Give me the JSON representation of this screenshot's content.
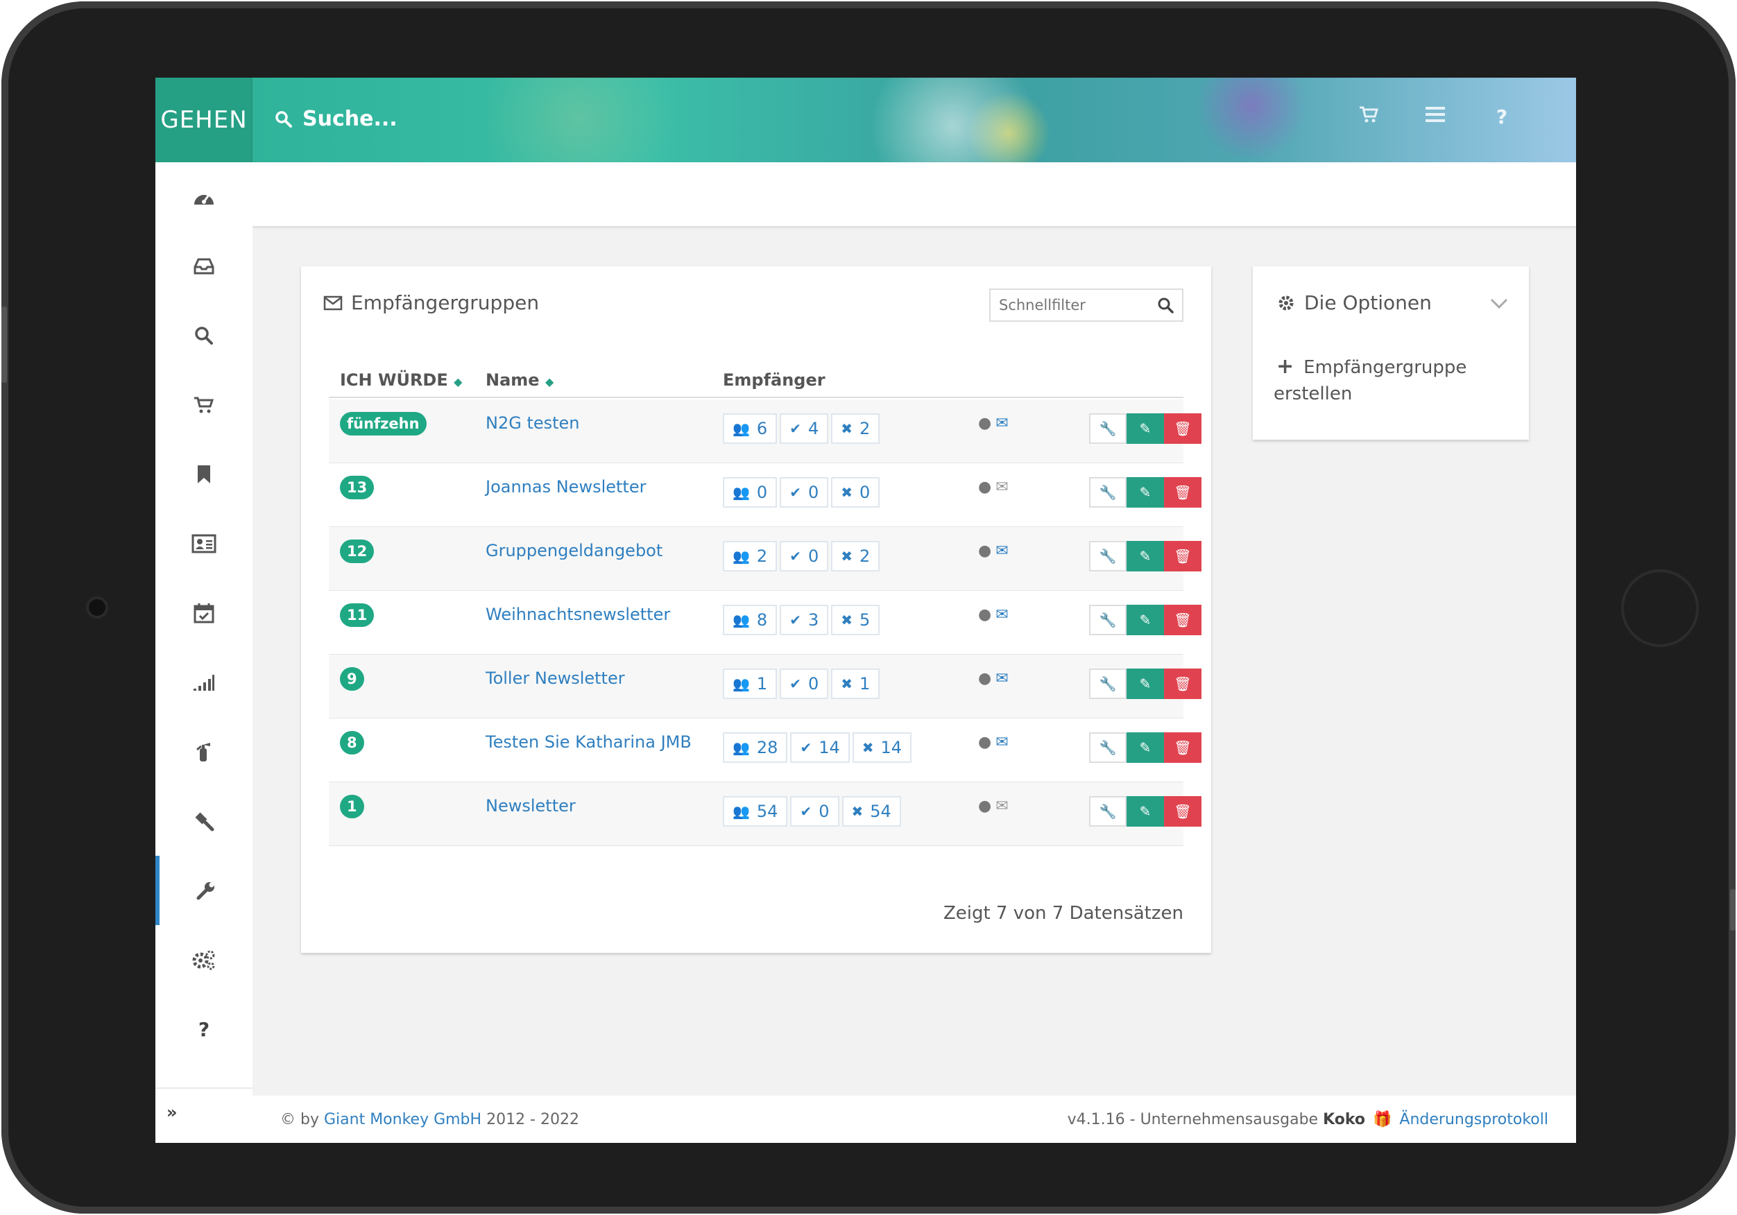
{
  "brand": "GEHEN",
  "search": {
    "placeholder": "Suche..."
  },
  "top_icons": [
    "cart-icon",
    "list-icon",
    "help-icon"
  ],
  "sidebar": {
    "items": [
      {
        "icon": "dashboard-icon"
      },
      {
        "icon": "inbox-icon"
      },
      {
        "icon": "search-icon"
      },
      {
        "icon": "cart-icon"
      },
      {
        "icon": "bookmark-icon"
      },
      {
        "icon": "contact-card-icon"
      },
      {
        "icon": "calendar-check-icon"
      },
      {
        "icon": "signal-bars-icon"
      },
      {
        "icon": "fire-extinguisher-icon"
      },
      {
        "icon": "gavel-icon"
      },
      {
        "icon": "wrench-icon",
        "active": true
      },
      {
        "icon": "gears-icon"
      },
      {
        "icon": "question-icon"
      }
    ],
    "collapse": "»"
  },
  "panel": {
    "title": "Empfängergruppen",
    "filter_placeholder": "Schnellfilter",
    "columns": {
      "id": "ICH WÜRDE",
      "name": "Name",
      "recipients": "Empfänger"
    },
    "rows": [
      {
        "id": "fünfzehn",
        "name": "N2G testen",
        "total": "6",
        "active": "4",
        "inactive": "2",
        "mail": true
      },
      {
        "id": "13",
        "name": "Joannas Newsletter",
        "total": "0",
        "active": "0",
        "inactive": "0",
        "mail": false
      },
      {
        "id": "12",
        "name": "Gruppengeldangebot",
        "total": "2",
        "active": "0",
        "inactive": "2",
        "mail": true
      },
      {
        "id": "11",
        "name": "Weihnachtsnewsletter",
        "total": "8",
        "active": "3",
        "inactive": "5",
        "mail": true
      },
      {
        "id": "9",
        "name": "Toller Newsletter",
        "total": "1",
        "active": "0",
        "inactive": "1",
        "mail": true
      },
      {
        "id": "8",
        "name": "Testen Sie Katharina JMB",
        "total": "28",
        "active": "14",
        "inactive": "14",
        "mail": true
      },
      {
        "id": "1",
        "name": "Newsletter",
        "total": "54",
        "active": "0",
        "inactive": "54",
        "mail": false
      }
    ],
    "records": "Zeigt 7 von 7 Datensätzen"
  },
  "options": {
    "title": "Die Optionen",
    "create": "Empfängergruppe erstellen"
  },
  "footer": {
    "copyright": "© by",
    "company": "Giant Monkey GmbH",
    "years": "2012 - 2022",
    "version": "v4.1.16 - Unternehmensausgabe",
    "edition": "Koko",
    "changelog": "Änderungsprotokoll"
  },
  "colors": {
    "accent": "#26a085",
    "link": "#2f7fc0",
    "danger": "#e0434f"
  }
}
